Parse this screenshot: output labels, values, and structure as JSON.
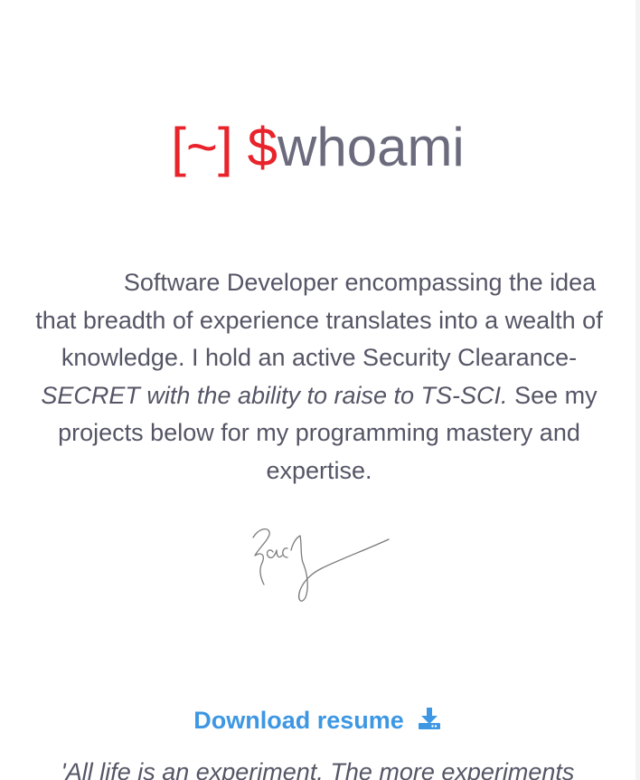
{
  "header": {
    "bracket": "[~]",
    "dollar": "$",
    "command": "whoami"
  },
  "bio": {
    "intro": "Software Developer encompassing the idea that breadth of experience translates into a wealth of knowledge. I hold an active Security Clearance- ",
    "emphasis": "SECRET with the ability to raise to TS-SCI.",
    "outro": " See my projects below for my programming mastery and expertise."
  },
  "signature": {
    "icon": "handwritten-signature",
    "text": "Zach"
  },
  "download": {
    "label": "Download resume",
    "icon": "download-icon"
  },
  "quote": {
    "text": "'All life is an experiment. The more experiments"
  },
  "colors": {
    "accent_red": "#e8232b",
    "heading_gray": "#6b6b7d",
    "body_text": "#555566",
    "link_blue": "#3d97e3"
  }
}
